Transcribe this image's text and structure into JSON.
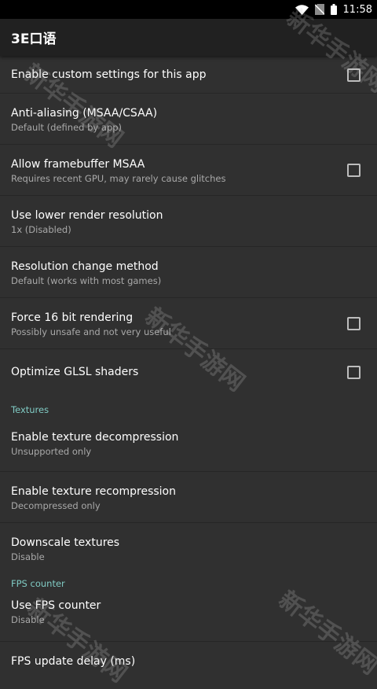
{
  "status_bar": {
    "time": "11:58",
    "icons": [
      "wifi-icon",
      "no-sim-icon",
      "battery-icon"
    ]
  },
  "app_bar": {
    "title": "3E口语"
  },
  "settings": {
    "custom": {
      "title": "Enable custom settings for this app",
      "checked": false
    },
    "aa": {
      "title": "Anti-aliasing (MSAA/CSAA)",
      "summary": "Default (defined by app)"
    },
    "fb_msaa": {
      "title": "Allow framebuffer MSAA",
      "summary": "Requires recent GPU, may rarely cause glitches",
      "checked": false
    },
    "lower_res": {
      "title": "Use lower render resolution",
      "summary": "1x (Disabled)"
    },
    "res_method": {
      "title": "Resolution change method",
      "summary": "Default (works with most games)"
    },
    "force16": {
      "title": "Force 16 bit rendering",
      "summary": "Possibly unsafe and not very useful",
      "checked": false
    },
    "glsl": {
      "title": "Optimize GLSL shaders",
      "checked": false
    }
  },
  "textures": {
    "header": "Textures",
    "decomp": {
      "title": "Enable texture decompression",
      "summary": "Unsupported only"
    },
    "recomp": {
      "title": "Enable texture recompression",
      "summary": "Decompressed only"
    },
    "downscale": {
      "title": "Downscale textures",
      "summary": "Disable"
    }
  },
  "fps": {
    "header": "FPS counter",
    "use": {
      "title": "Use FPS counter",
      "summary": "Disable"
    },
    "delay": {
      "title": "FPS update delay (ms)"
    }
  },
  "watermark": "新华手游网",
  "colors": {
    "background": "#303030",
    "app_bar": "#212121",
    "accent": "#80cbc4",
    "secondary_text": "#a9a9a9"
  }
}
